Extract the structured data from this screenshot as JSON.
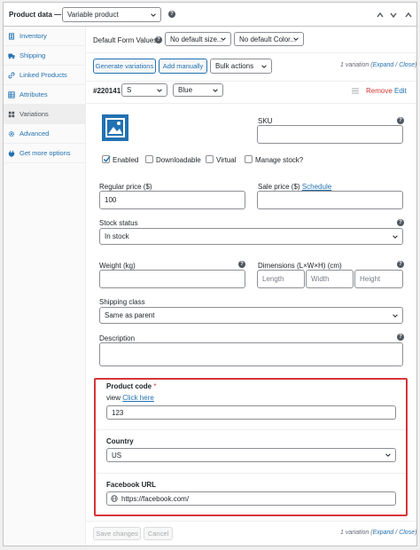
{
  "header": {
    "title": "Product data —",
    "product_type": "Variable product"
  },
  "sidebar": {
    "items": [
      {
        "label": "Inventory",
        "icon": "inventory-icon"
      },
      {
        "label": "Shipping",
        "icon": "truck-icon"
      },
      {
        "label": "Linked Products",
        "icon": "link-icon"
      },
      {
        "label": "Attributes",
        "icon": "list-icon"
      },
      {
        "label": "Variations",
        "icon": "grid-icon"
      },
      {
        "label": "Advanced",
        "icon": "gear-icon"
      },
      {
        "label": "Get more options",
        "icon": "plugin-icon"
      }
    ]
  },
  "defaults": {
    "label": "Default Form Values:",
    "size": "No default size...",
    "color": "No default Color..."
  },
  "toolbar": {
    "generate": "Generate variations",
    "add_manually": "Add manually",
    "bulk_actions": "Bulk actions",
    "count": "1 variation",
    "expand": "Expand",
    "close": "Close",
    "sep": "/"
  },
  "variation": {
    "id": "#220141",
    "size": "S",
    "color": "Blue",
    "remove": "Remove",
    "edit": "Edit",
    "sku_label": "SKU",
    "enabled": "Enabled",
    "downloadable": "Downloadable",
    "virtual": "Virtual",
    "manage_stock": "Manage stock?",
    "regular_price_label": "Regular price ($)",
    "regular_price": "100",
    "sale_price_label": "Sale price ($)",
    "schedule": "Schedule",
    "stock_status_label": "Stock status",
    "stock_status": "In stock",
    "weight_label": "Weight (kg)",
    "dimensions_label": "Dimensions (L×W×H) (cm)",
    "length_ph": "Length",
    "width_ph": "Width",
    "height_ph": "Height",
    "shipping_class_label": "Shipping class",
    "shipping_class": "Same as parent",
    "description_label": "Description"
  },
  "custom_fields": {
    "product_code_label": "Product code",
    "required_mark": "*",
    "view_prefix": "view",
    "click_here": "Click here",
    "product_code": "123",
    "country_label": "Country",
    "country": "US",
    "facebook_label": "Facebook URL",
    "facebook_url": "https://facebook.com/"
  },
  "footer": {
    "save": "Save changes",
    "cancel": "Cancel",
    "count": "1 variation",
    "expand": "Expand",
    "close": "Close",
    "sep": "/"
  },
  "colors": {
    "accent": "#2271b1",
    "remove": "#d63638",
    "highlight_border": "#d63638"
  }
}
